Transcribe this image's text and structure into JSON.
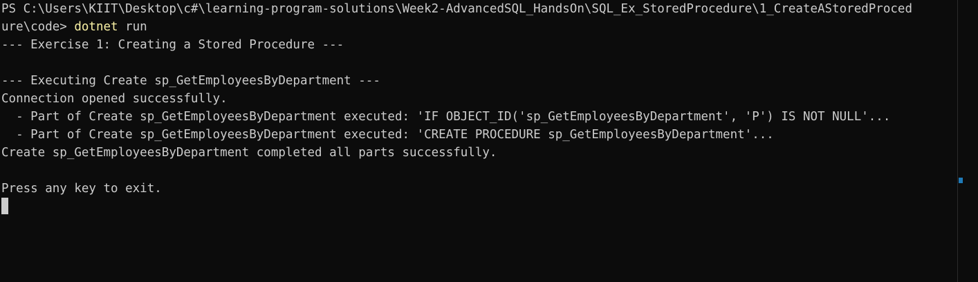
{
  "terminal": {
    "prompt_line1": "PS C:\\Users\\KIIT\\Desktop\\c#\\learning-program-solutions\\Week2-AdvancedSQL_HandsOn\\SQL_Ex_StoredProcedure\\1_CreateAStoredProced",
    "prompt_line2": "ure\\code> ",
    "command_keyword": "dotnet",
    "command_args": " run",
    "output": [
      "--- Exercise 1: Creating a Stored Procedure ---",
      "",
      "--- Executing Create sp_GetEmployeesByDepartment ---",
      "Connection opened successfully.",
      "  - Part of Create sp_GetEmployeesByDepartment executed: 'IF OBJECT_ID('sp_GetEmployeesByDepartment', 'P') IS NOT NULL'...",
      "  - Part of Create sp_GetEmployeesByDepartment executed: 'CREATE PROCEDURE sp_GetEmployeesByDepartment'...",
      "Create sp_GetEmployeesByDepartment completed all parts successfully.",
      "",
      "Press any key to exit."
    ]
  },
  "colors": {
    "background": "#0c0c0c",
    "foreground": "#cccccc",
    "command": "#f9f1a5",
    "scroll_marker": "#1e7ab8"
  }
}
